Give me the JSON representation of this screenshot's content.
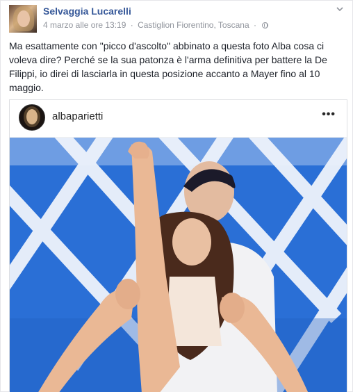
{
  "post": {
    "author": "Selvaggia Lucarelli",
    "date": "4 marzo alle ore 13:19",
    "location": "Castiglion Fiorentino, Toscana",
    "separator": "·",
    "audience_icon": "globe-icon",
    "menu_icon": "chevron-down-icon",
    "text": "Ma esattamente con \"picco d'ascolto\" abbinato a questa foto Alba cosa ci voleva dire? Perché se la sua patonza è l'arma definitiva per battere la De Filippi, io direi di lasciarla in questa posizione accanto a Mayer fino al 10 maggio."
  },
  "embed": {
    "username": "albaparietti",
    "more_label": "•••",
    "photo_description_icon": "dance-photo"
  },
  "colors": {
    "link": "#365899",
    "meta": "#90949c",
    "stage_blue": "#2a6fd6",
    "stage_white": "#eef3fb"
  }
}
